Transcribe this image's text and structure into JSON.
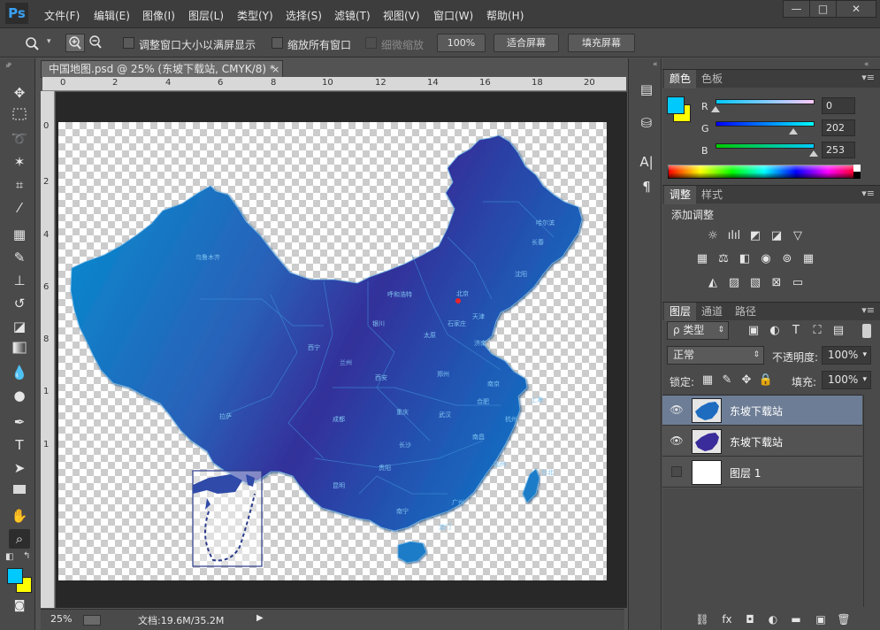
{
  "app": {
    "logo": "Ps"
  },
  "menu": [
    "文件(F)",
    "编辑(E)",
    "图像(I)",
    "图层(L)",
    "类型(Y)",
    "选择(S)",
    "滤镜(T)",
    "视图(V)",
    "窗口(W)",
    "帮助(H)"
  ],
  "window_controls": {
    "minimize": "—",
    "maximize": "□",
    "close": "✕"
  },
  "options": {
    "resize_window": "调整窗口大小以满屏显示",
    "zoom_all": "缩放所有窗口",
    "scrubby": "细微缩放",
    "zoom_100": "100%",
    "fit_screen": "适合屏幕",
    "fill_screen": "填充屏幕"
  },
  "document": {
    "tab_title": "中国地图.psd @ 25% (东坡下载站, CMYK/8) *",
    "tab_close": "×",
    "zoom": "25%",
    "doc_info": "文档:19.6M/35.2M",
    "ruler_top": [
      "0",
      "2",
      "4",
      "6",
      "8",
      "10",
      "12",
      "14",
      "16",
      "18",
      "20"
    ],
    "ruler_left": [
      "0",
      "2",
      "4",
      "6",
      "8",
      "1",
      "1"
    ]
  },
  "map_labels": [
    "乌鲁木齐",
    "呼和浩特",
    "北京",
    "天津",
    "银川",
    "太原",
    "石家庄",
    "济南",
    "西宁",
    "兰州",
    "西安",
    "郑州",
    "合肥",
    "南京",
    "上海",
    "拉萨",
    "成都",
    "重庆",
    "武汉",
    "杭州",
    "长沙",
    "南昌",
    "福州",
    "台北",
    "贵阳",
    "昆明",
    "南宁",
    "广州",
    "澳门",
    "哈尔滨",
    "长春",
    "沈阳"
  ],
  "color_panel": {
    "tabs": [
      "颜色",
      "色板"
    ],
    "r_label": "R",
    "g_label": "G",
    "b_label": "B",
    "r": "0",
    "g": "202",
    "b": "253",
    "foreground": "#00cafd",
    "background": "#ffff00"
  },
  "adjust_panel": {
    "tabs": [
      "调整",
      "样式"
    ],
    "title": "添加调整"
  },
  "layers_panel": {
    "tabs": [
      "图层",
      "通道",
      "路径"
    ],
    "filter_label": "ρ 类型",
    "blend_mode": "正常",
    "opacity_label": "不透明度:",
    "opacity": "100%",
    "lock_label": "锁定:",
    "fill_label": "填充:",
    "fill": "100%",
    "layers": [
      {
        "name": "东坡下载站",
        "visible": true,
        "selected": true
      },
      {
        "name": "东坡下载站",
        "visible": true,
        "selected": false
      },
      {
        "name": "图层 1",
        "visible": false,
        "selected": false
      }
    ]
  }
}
